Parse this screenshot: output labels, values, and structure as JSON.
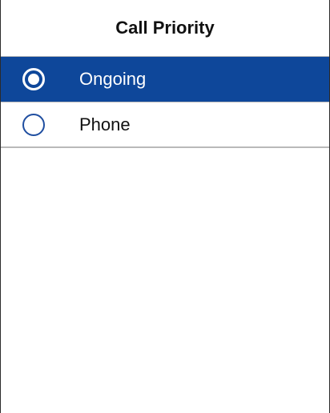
{
  "header": {
    "title": "Call Priority"
  },
  "options": [
    {
      "label": "Ongoing",
      "selected": true,
      "icon": "radio-selected-icon"
    },
    {
      "label": "Phone",
      "selected": false,
      "icon": "radio-unselected-icon"
    }
  ],
  "colors": {
    "accent": "#0e479a",
    "radio_outline": "#1f4ea0",
    "divider": "#b9b9b9"
  }
}
